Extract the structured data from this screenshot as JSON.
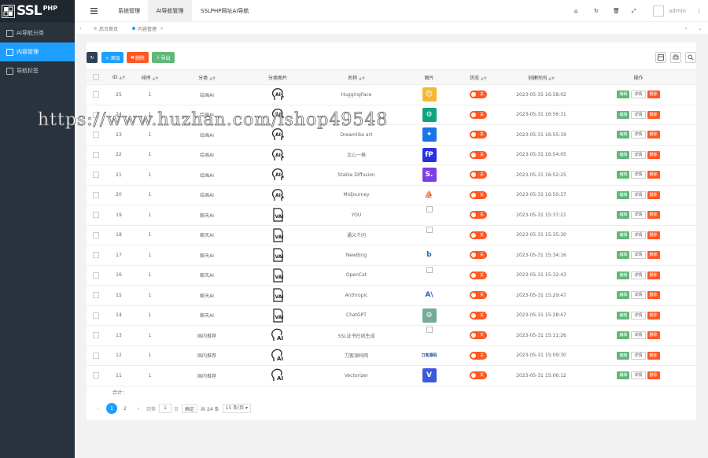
{
  "logo": {
    "text": "SSL",
    "sup": "PHP"
  },
  "sidebar": {
    "items": [
      {
        "label": "AI导航分类"
      },
      {
        "label": "内容管理"
      },
      {
        "label": "导航标签"
      }
    ]
  },
  "header": {
    "tabs": [
      {
        "label": "系统管理"
      },
      {
        "label": "AI导航管理"
      },
      {
        "label": "SSLPHP网址AI导航"
      }
    ],
    "user": "admin"
  },
  "tabbar": {
    "home": "后台首页",
    "current": "内容管理"
  },
  "toolbar": {
    "add": "+ 添加",
    "delete": "删除",
    "export": "导出"
  },
  "table": {
    "headers": [
      "ID",
      "排序",
      "分类",
      "分类图片",
      "名称",
      "图片",
      "状态",
      "创建时间",
      "操作"
    ],
    "rows": [
      {
        "id": "25",
        "sort": "1",
        "cat": "绘画AI",
        "name": "HuggingFace",
        "time": "2023-05-31 16:58:02",
        "cat_icon": "ai-head",
        "img": "emoji",
        "img_color": "#f7b733",
        "img_text": "😊"
      },
      {
        "id": "24",
        "sort": "1",
        "cat": "绘画AI",
        "name": "",
        "time": "2023-05-31 16:56:31",
        "cat_icon": "ai-head",
        "img": "logo",
        "img_color": "#10a37f",
        "img_text": "⚙"
      },
      {
        "id": "23",
        "sort": "1",
        "cat": "绘画AI",
        "name": "Dreamlike art",
        "time": "2023-05-31 16:55:19",
        "cat_icon": "ai-head",
        "img": "logo",
        "img_color": "#1a73e8",
        "img_text": "✦"
      },
      {
        "id": "22",
        "sort": "1",
        "cat": "绘画AI",
        "name": "文心一格",
        "time": "2023-05-31 16:54:05",
        "cat_icon": "ai-head",
        "img": "logo",
        "img_color": "#2932e1",
        "img_text": "fP"
      },
      {
        "id": "21",
        "sort": "1",
        "cat": "绘画AI",
        "name": "Stable Diffusion",
        "time": "2023-05-31 16:52:25",
        "cat_icon": "ai-head",
        "img": "letter",
        "img_color": "#7b3fe4",
        "img_text": "S."
      },
      {
        "id": "20",
        "sort": "1",
        "cat": "绘画AI",
        "name": "Midjourney",
        "time": "2023-05-31 16:50:37",
        "cat_icon": "ai-head",
        "img": "logo",
        "img_color": "#ffffff",
        "img_text": "⛵"
      },
      {
        "id": "19",
        "sort": "1",
        "cat": "聊天AI",
        "name": "YOU",
        "time": "2023-05-31 15:37:21",
        "cat_icon": "ai-doc",
        "img": "broken",
        "img_color": "",
        "img_text": ""
      },
      {
        "id": "18",
        "sort": "1",
        "cat": "聊天AI",
        "name": "通义千问",
        "time": "2023-05-31 15:35:30",
        "cat_icon": "ai-doc",
        "img": "broken",
        "img_color": "",
        "img_text": ""
      },
      {
        "id": "17",
        "sort": "1",
        "cat": "聊天AI",
        "name": "NewBing",
        "time": "2023-05-31 15:34:16",
        "cat_icon": "ai-doc",
        "img": "logo",
        "img_color": "#ffffff",
        "img_text": "b"
      },
      {
        "id": "16",
        "sort": "1",
        "cat": "聊天AI",
        "name": "OpenCat",
        "time": "2023-05-31 15:32:43",
        "cat_icon": "ai-doc",
        "img": "broken",
        "img_color": "",
        "img_text": ""
      },
      {
        "id": "15",
        "sort": "1",
        "cat": "聊天AI",
        "name": "Anthropic",
        "time": "2023-05-31 15:29:47",
        "cat_icon": "ai-doc",
        "img": "letter",
        "img_color": "#ffffff",
        "img_text": "A\\"
      },
      {
        "id": "14",
        "sort": "1",
        "cat": "聊天AI",
        "name": "ChatGPT",
        "time": "2023-05-31 15:28:47",
        "cat_icon": "ai-doc",
        "img": "logo",
        "img_color": "#74aa9c",
        "img_text": "⚙"
      },
      {
        "id": "13",
        "sort": "1",
        "cat": "国内推荐",
        "name": "SSL证书在线生成",
        "time": "2023-05-31 15:11:26",
        "cat_icon": "ai-head2",
        "img": "broken",
        "img_color": "",
        "img_text": ""
      },
      {
        "id": "12",
        "sort": "1",
        "cat": "国内推荐",
        "name": "刀客源码网",
        "time": "2023-05-31 15:09:30",
        "cat_icon": "ai-head2",
        "img": "text",
        "img_color": "#ffffff",
        "img_text": "刀客源码"
      },
      {
        "id": "11",
        "sort": "1",
        "cat": "国内推荐",
        "name": "Vectorizer",
        "time": "2023-05-31 15:06:12",
        "cat_icon": "ai-head2",
        "img": "logo",
        "img_color": "#3b5bdb",
        "img_text": "V"
      }
    ],
    "status_label": "关",
    "actions": {
      "edit": "编辑",
      "detail": "详情",
      "delete": "删除"
    },
    "total_label": "合计："
  },
  "pager": {
    "pages": [
      "1",
      "2"
    ],
    "goto": "到第",
    "page_val": "1",
    "page_unit": "页",
    "confirm": "确定",
    "total": "共 24 条",
    "per_page": "15 条/页"
  },
  "watermark": "https://www.huzhan.com/ishop49548",
  "colors": {
    "primary": "#1e9fff",
    "sidebar": "#28333e",
    "success": "#5fb878",
    "danger": "#ff5722",
    "dark": "#2f4056"
  }
}
